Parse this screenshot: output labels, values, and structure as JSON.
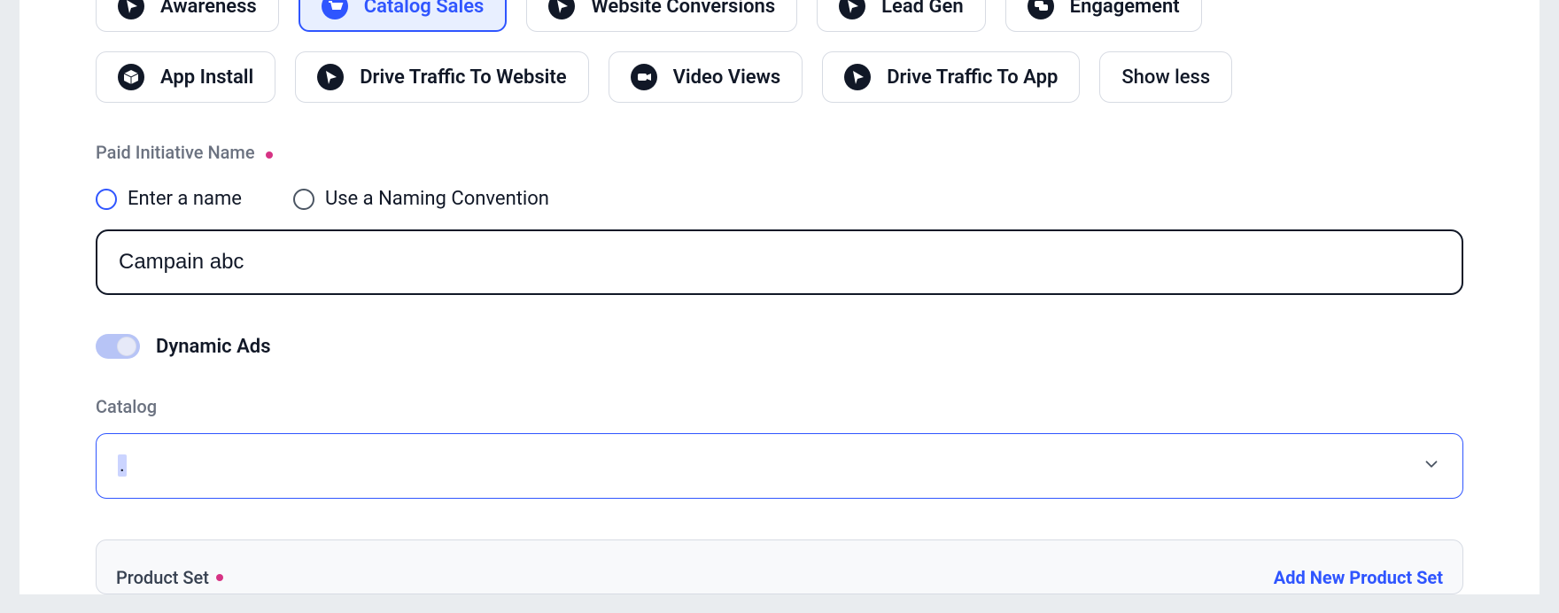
{
  "objectives": {
    "row1": [
      {
        "id": "awareness",
        "label": "Awareness",
        "icon": "cursor",
        "selected": false
      },
      {
        "id": "catalog-sales",
        "label": "Catalog Sales",
        "icon": "cart",
        "selected": true
      },
      {
        "id": "website-conversions",
        "label": "Website Conversions",
        "icon": "cursor",
        "selected": false
      },
      {
        "id": "lead-gen",
        "label": "Lead Gen",
        "icon": "cursor",
        "selected": false
      },
      {
        "id": "engagement",
        "label": "Engagement",
        "icon": "messages",
        "selected": false
      }
    ],
    "row2": [
      {
        "id": "app-install",
        "label": "App Install",
        "icon": "cube",
        "selected": false
      },
      {
        "id": "drive-traffic-web",
        "label": "Drive Traffic To Website",
        "icon": "cursor",
        "selected": false
      },
      {
        "id": "video-views",
        "label": "Video Views",
        "icon": "camera",
        "selected": false
      },
      {
        "id": "drive-traffic-app",
        "label": "Drive Traffic To App",
        "icon": "cursor",
        "selected": false
      }
    ],
    "show_less": "Show less"
  },
  "paid_initiative": {
    "label": "Paid Initiative Name",
    "radios": {
      "enter": "Enter a name",
      "convention": "Use a Naming Convention"
    },
    "value": "Campain abc"
  },
  "dynamic_ads": {
    "label": "Dynamic Ads",
    "on": true
  },
  "catalog": {
    "label": "Catalog",
    "value": "."
  },
  "product_set": {
    "label": "Product Set",
    "add_link": "Add New Product Set"
  }
}
